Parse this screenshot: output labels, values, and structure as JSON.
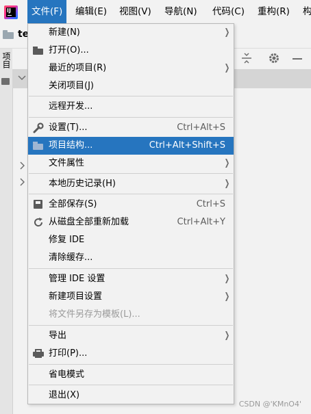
{
  "menubar": {
    "logo_text": "IJ",
    "items": [
      {
        "label": "文件(F)"
      },
      {
        "label": "编辑(E)"
      },
      {
        "label": "视图(V)"
      },
      {
        "label": "导航(N)"
      },
      {
        "label": "代码(C)"
      },
      {
        "label": "重构(R)"
      },
      {
        "label": "构"
      }
    ]
  },
  "toolbar": {
    "project_name": "te"
  },
  "side_panel": {
    "tab_label": "项目"
  },
  "file_menu": {
    "items": [
      {
        "label": "新建(N)",
        "shortcut": "",
        "has_submenu": true
      },
      {
        "label": "打开(O)...",
        "shortcut": "",
        "icon": "folder-open-icon"
      },
      {
        "label": "最近的项目(R)",
        "shortcut": "",
        "has_submenu": true
      },
      {
        "label": "关闭项目(J)",
        "shortcut": ""
      },
      {
        "label": "远程开发...",
        "shortcut": ""
      },
      {
        "label": "设置(T)...",
        "shortcut": "Ctrl+Alt+S",
        "icon": "wrench-icon"
      },
      {
        "label": "项目结构...",
        "shortcut": "Ctrl+Alt+Shift+S",
        "icon": "project-structure-icon",
        "selected": true
      },
      {
        "label": "文件属性",
        "shortcut": "",
        "has_submenu": true
      },
      {
        "label": "本地历史记录(H)",
        "shortcut": "",
        "has_submenu": true
      },
      {
        "label": "全部保存(S)",
        "shortcut": "Ctrl+S",
        "icon": "save-icon"
      },
      {
        "label": "从磁盘全部重新加载",
        "shortcut": "Ctrl+Alt+Y",
        "icon": "reload-icon"
      },
      {
        "label": "修复 IDE",
        "shortcut": ""
      },
      {
        "label": "清除缓存...",
        "shortcut": ""
      },
      {
        "label": "管理 IDE 设置",
        "shortcut": "",
        "has_submenu": true
      },
      {
        "label": "新建项目设置",
        "shortcut": "",
        "has_submenu": true
      },
      {
        "label": "将文件另存为模板(L)...",
        "shortcut": "",
        "disabled": true
      },
      {
        "label": "导出",
        "shortcut": "",
        "has_submenu": true
      },
      {
        "label": "打印(P)...",
        "shortcut": "",
        "icon": "printer-icon"
      },
      {
        "label": "省电模式",
        "shortcut": ""
      },
      {
        "label": "退出(X)",
        "shortcut": ""
      }
    ]
  },
  "watermark": "CSDN @'KMnO4'",
  "colors": {
    "accent": "#2675bf",
    "menu_bg": "#f2f2f2"
  }
}
